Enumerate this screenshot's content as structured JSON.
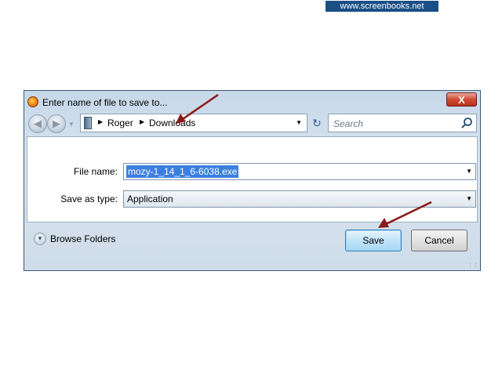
{
  "watermark": "www.screenbooks.net",
  "dialog": {
    "title": "Enter name of file to save to...",
    "close_label": "X",
    "address": {
      "crumbs": [
        "Roger",
        "Downloads"
      ]
    },
    "search": {
      "placeholder": "Search"
    },
    "file_name": {
      "label": "File name:",
      "value": "mozy-1_14_1_6-6038.exe"
    },
    "save_as_type": {
      "label": "Save as type:",
      "value": "Application"
    },
    "browse_folders_label": "Browse Folders",
    "save_label": "Save",
    "cancel_label": "Cancel"
  },
  "colors": {
    "watermark_bg": "#1a4f86",
    "annotation_arrow": "#8b1a1a",
    "selection": "#3d7fe0"
  }
}
